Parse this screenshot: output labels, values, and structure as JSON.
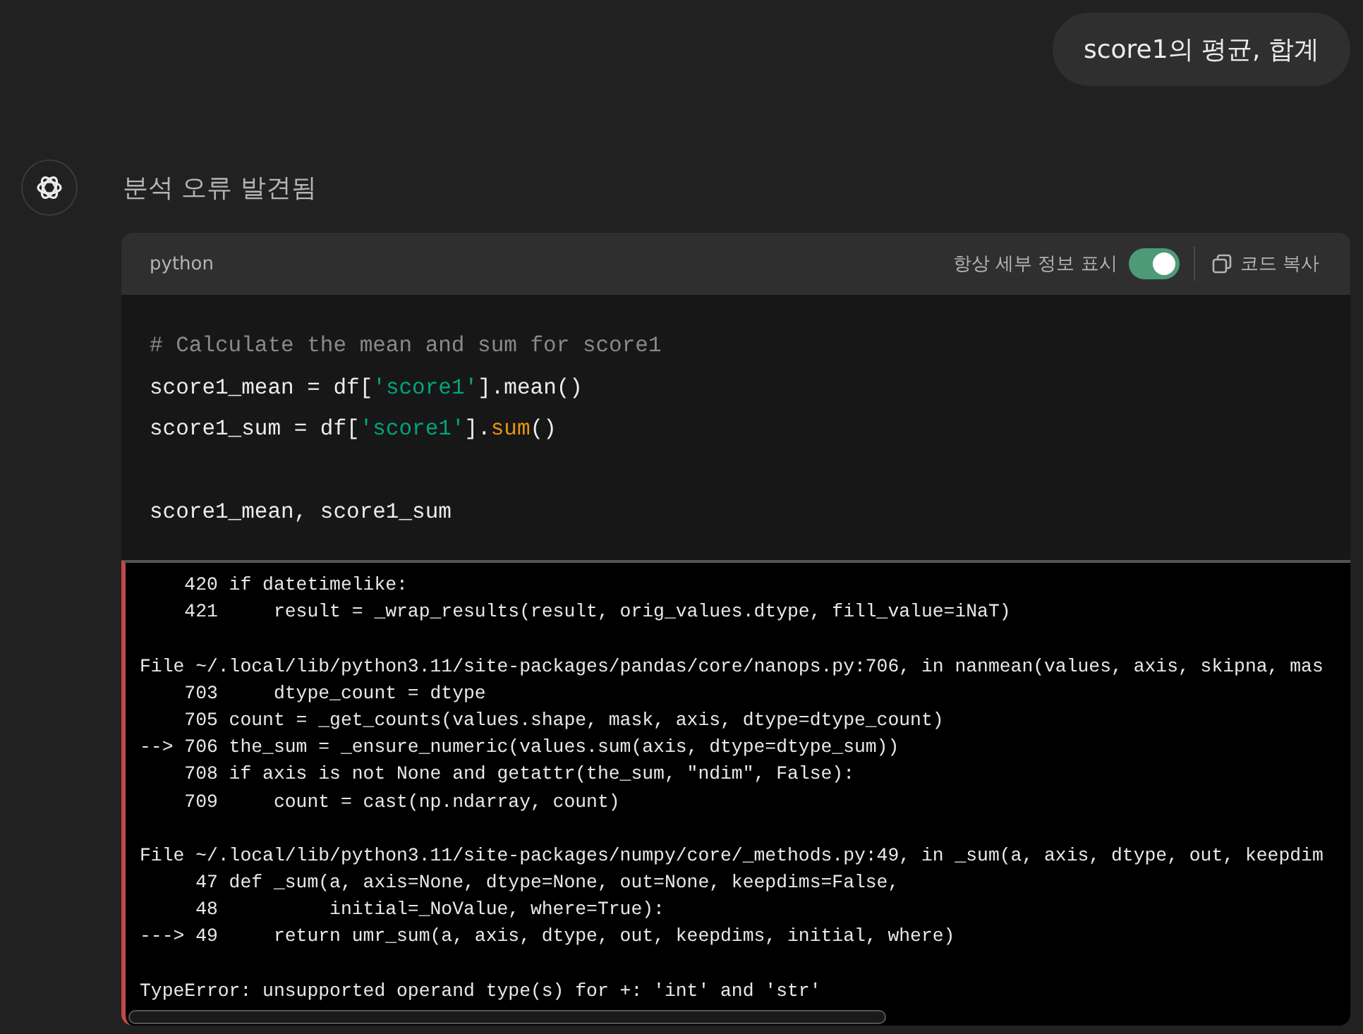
{
  "user_message": "score1의 평균, 합계",
  "assistant": {
    "status": "분석 오류 발견됨"
  },
  "code_block": {
    "language": "python",
    "toggle": {
      "label": "항상 세부 정보 표시",
      "on": true
    },
    "copy_button": "코드 복사",
    "blocks": [
      [
        [
          {
            "kind": "comment",
            "text": "# Calculate the mean and sum for score1"
          }
        ],
        [
          {
            "kind": "plain",
            "text": "score1_mean = df["
          },
          {
            "kind": "string",
            "text": "'score1'"
          },
          {
            "kind": "plain",
            "text": "].mean()"
          }
        ],
        [
          {
            "kind": "plain",
            "text": "score1_sum = df["
          },
          {
            "kind": "string",
            "text": "'score1'"
          },
          {
            "kind": "plain",
            "text": "]."
          },
          {
            "kind": "builtin",
            "text": "sum"
          },
          {
            "kind": "plain",
            "text": "()"
          }
        ]
      ],
      [
        [
          {
            "kind": "plain",
            "text": "score1_mean, score1_sum"
          }
        ]
      ]
    ]
  },
  "error_output": [
    [
      "    420 if datetimelike:",
      "    421     result = _wrap_results(result, orig_values.dtype, fill_value=iNaT)"
    ],
    [
      "File ~/.local/lib/python3.11/site-packages/pandas/core/nanops.py:706, in nanmean(values, axis, skipna, mas",
      "    703     dtype_count = dtype",
      "    705 count = _get_counts(values.shape, mask, axis, dtype=dtype_count)",
      "--> 706 the_sum = _ensure_numeric(values.sum(axis, dtype=dtype_sum))",
      "    708 if axis is not None and getattr(the_sum, \"ndim\", False):",
      "    709     count = cast(np.ndarray, count)"
    ],
    [
      "File ~/.local/lib/python3.11/site-packages/numpy/core/_methods.py:49, in _sum(a, axis, dtype, out, keepdim",
      "     47 def _sum(a, axis=None, dtype=None, out=None, keepdims=False,",
      "     48          initial=_NoValue, where=True):",
      "---> 49     return umr_sum(a, axis, dtype, out, keepdims, initial, where)"
    ],
    [
      "TypeError: unsupported operand type(s) for +: 'int' and 'str'"
    ]
  ]
}
